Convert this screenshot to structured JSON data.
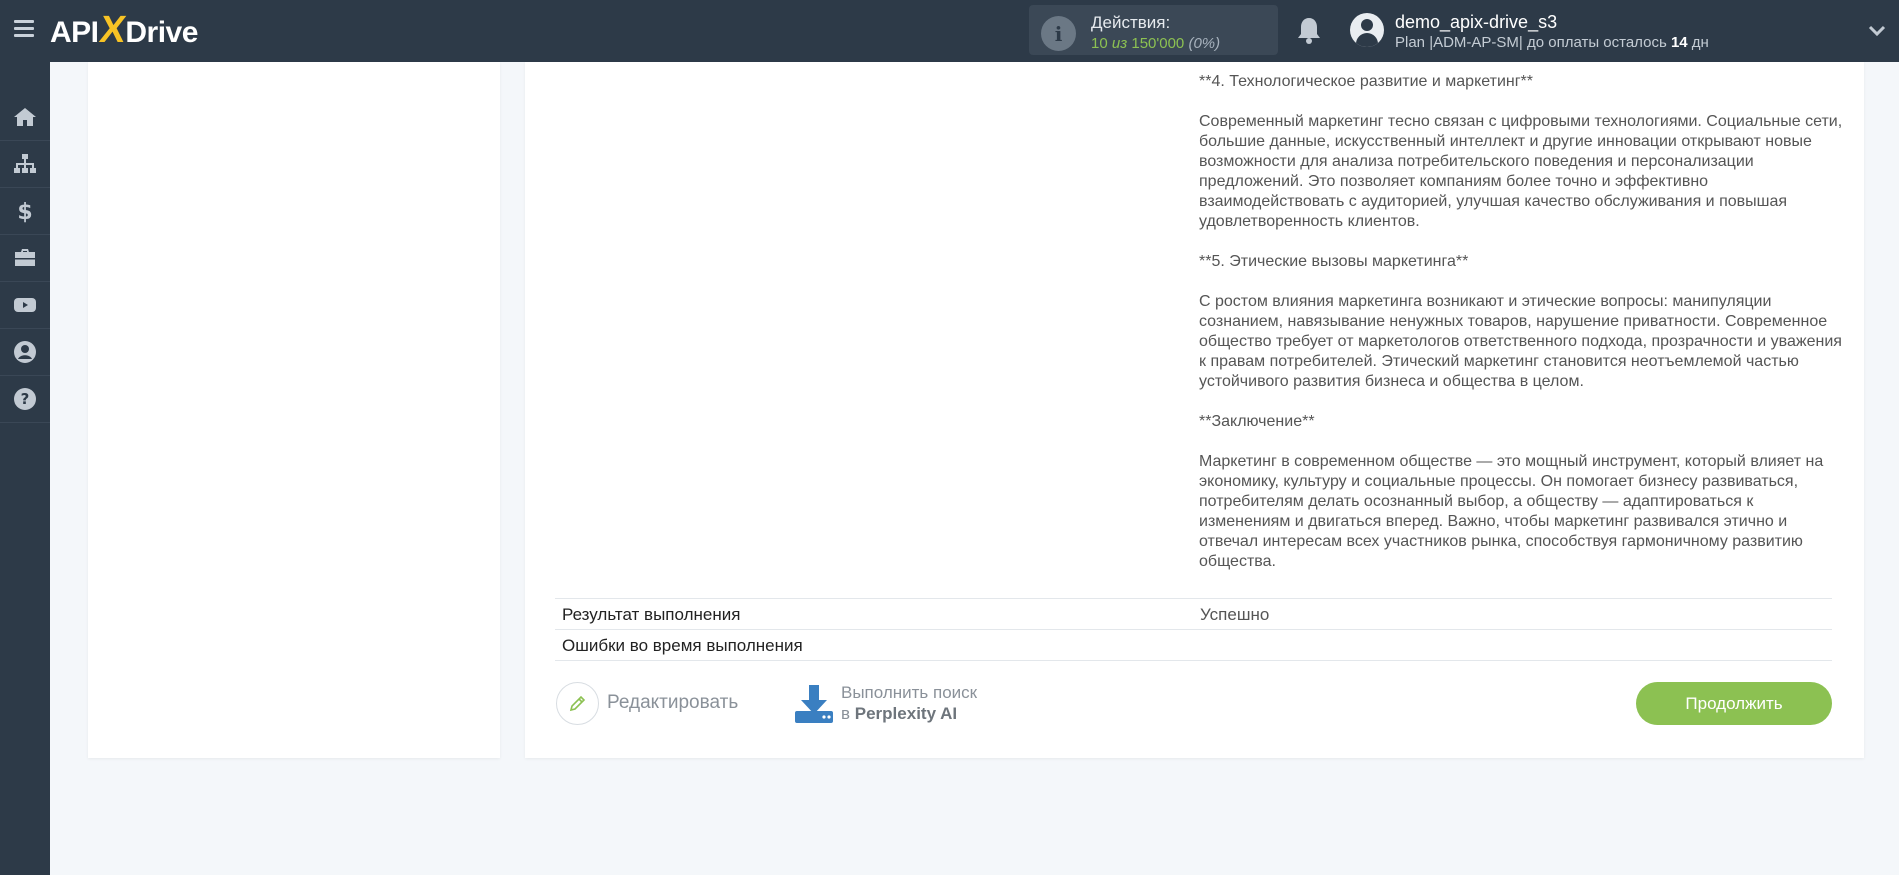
{
  "header": {
    "logo_left": "API",
    "logo_x": "X",
    "logo_right": "Drive",
    "actions_label": "Действия:",
    "actions_used": "10",
    "actions_of": "из",
    "actions_total": "150'000",
    "actions_pct": "(0%)",
    "username": "demo_apix-drive_s3",
    "plan_prefix": "Plan |ADM-AP-SM| до оплаты осталось",
    "plan_days": "14",
    "plan_suffix": "дн"
  },
  "sidebar": {
    "items": [
      "home-icon",
      "sitemap-icon",
      "dollar-icon",
      "briefcase-icon",
      "youtube-icon",
      "user-circle-icon",
      "question-circle-icon"
    ]
  },
  "result": {
    "paragraphs": [
      "**4. Технологическое развитие и маркетинг**",
      "Современный маркетинг тесно связан с цифровыми технологиями. Социальные сети, большие данные, искусственный интеллект и другие инновации открывают новые возможности для анализа потребительского поведения и персонализации предложений. Это позволяет компаниям более точно и эффективно взаимодействовать с аудиторией, улучшая качество обслуживания и повышая удовлетворенность клиентов.",
      "**5. Этические вызовы маркетинга**",
      "С ростом влияния маркетинга возникают и этические вопросы: манипуляции сознанием, навязывание ненужных товаров, нарушение приватности. Современное общество требует от маркетологов ответственного подхода, прозрачности и уважения к правам потребителей. Этический маркетинг становится неотъемлемой частью устойчивого развития бизнеса и общества в целом.",
      "**Заключение**",
      "Маркетинг в современном обществе — это мощный инструмент, который влияет на экономику, культуру и социальные процессы. Он помогает бизнесу развиваться, потребителям делать осознанный выбор, а обществу — адаптироваться к изменениям и двигаться вперед. Важно, чтобы маркетинг развивался этично и отвечал интересам всех участников рынка, способствуя гармоничному развитию общества."
    ]
  },
  "rows": {
    "status_key": "Результат выполнения",
    "status_value": "Успешно",
    "errors_key": "Ошибки во время выполнения",
    "errors_value": ""
  },
  "footer": {
    "edit_label": "Редактировать",
    "search_line1": "Выполнить поиск",
    "search_prefix": "в",
    "search_service": "Perplexity AI",
    "continue_label": "Продолжить"
  },
  "colors": {
    "topbar": "#2d3a48",
    "accent_green": "#8cc152",
    "logo_x": "#f7c325",
    "download_blue": "#3a7fc1"
  }
}
